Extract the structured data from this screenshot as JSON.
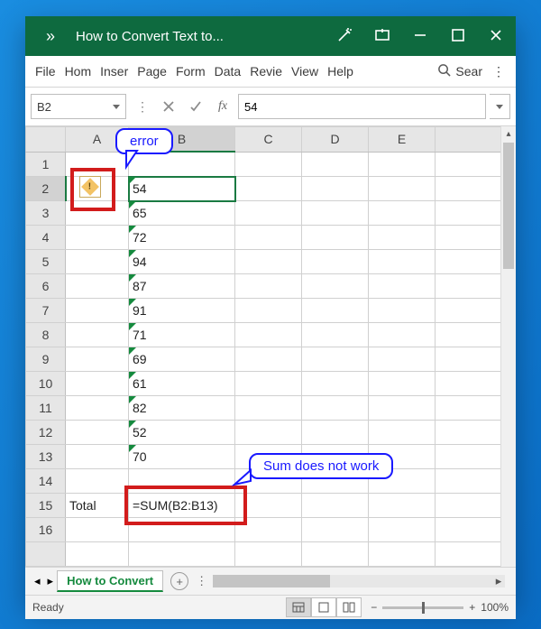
{
  "titlebar": {
    "overflow": "»",
    "title": "How to Convert Text to..."
  },
  "menu": {
    "file": "File",
    "home": "Hom",
    "insert": "Inser",
    "page": "Page",
    "formulas": "Form",
    "data": "Data",
    "review": "Revie",
    "view": "View",
    "help": "Help",
    "search": "Sear"
  },
  "fx": {
    "name": "B2",
    "fx_label": "fx",
    "value": "54",
    "dots": "⋮"
  },
  "columns": [
    "A",
    "B",
    "C",
    "D",
    "E"
  ],
  "rows": [
    "1",
    "2",
    "3",
    "4",
    "5",
    "6",
    "7",
    "8",
    "9",
    "10",
    "11",
    "12",
    "13",
    "14",
    "15",
    "16"
  ],
  "cells": {
    "B2": "54",
    "B3": "65",
    "B4": "72",
    "B5": "94",
    "B6": "87",
    "B7": "91",
    "B8": "71",
    "B9": "69",
    "B10": "61",
    "B11": "82",
    "B12": "52",
    "B13": "70",
    "A15": "Total",
    "B15": "=SUM(B2:B13)"
  },
  "callouts": {
    "error": "error",
    "sum": "Sum does not work"
  },
  "tabs": {
    "name": "How to Convert"
  },
  "status": {
    "ready": "Ready",
    "zoom": "100%"
  }
}
